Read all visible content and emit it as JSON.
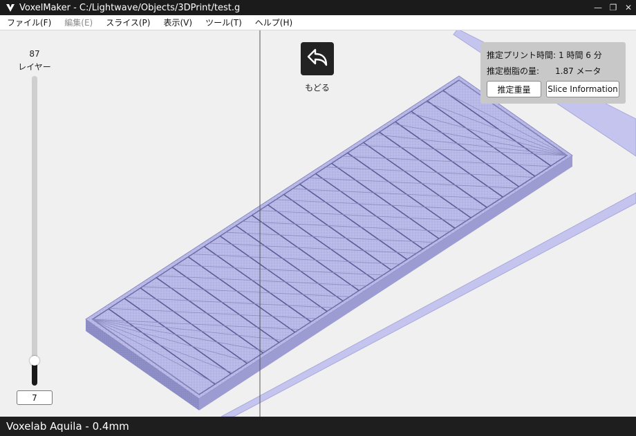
{
  "window": {
    "title": "VoxelMaker - C:/Lightwave/Objects/3DPrint/test.g",
    "controls": {
      "minimize": "—",
      "restore": "❐",
      "close": "✕"
    }
  },
  "menu": [
    {
      "label": "ファイル(F)",
      "enabled": true
    },
    {
      "label": "編集(E)",
      "enabled": false
    },
    {
      "label": "スライス(P)",
      "enabled": true
    },
    {
      "label": "表示(V)",
      "enabled": true
    },
    {
      "label": "ツール(T)",
      "enabled": true
    },
    {
      "label": "ヘルプ(H)",
      "enabled": true
    }
  ],
  "layers": {
    "total": "87",
    "label": "レイヤー",
    "current": "7",
    "slider_fraction": 0.08
  },
  "back": {
    "label": "もどる",
    "icon": "back-arrow-icon"
  },
  "info": {
    "time_label": "推定プリント時間:",
    "time_value": "1 時間 6 分",
    "resin_label": "推定樹脂の量:",
    "resin_value": "1.87 メータ",
    "weight_button": "推定重量",
    "slice_button": "Slice Information"
  },
  "status": {
    "printer": "Voxelab Aquila - 0.4mm"
  },
  "colors": {
    "model": "#b4b4e6",
    "model_side": "#8f8fc6",
    "bed_outline": "#c2c2ee",
    "titlebar": "#1b1b1b",
    "statusbar": "#1e1e1e"
  }
}
